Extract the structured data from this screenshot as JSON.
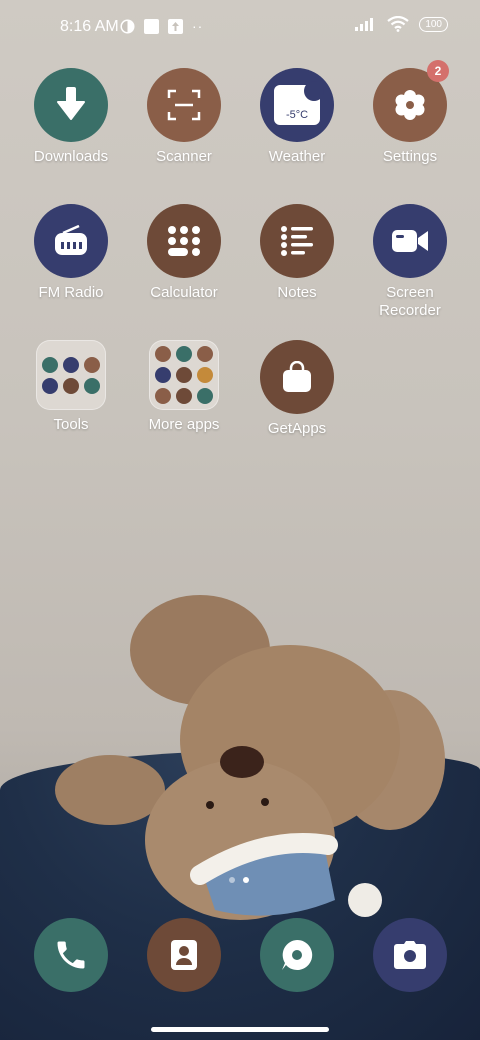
{
  "status_bar": {
    "time": "8:16 AM",
    "battery": "100",
    "icons": [
      "signal-icon",
      "wifi-icon",
      "battery-icon"
    ]
  },
  "apps": {
    "downloads": {
      "label": "Downloads",
      "color": "#3a6f68"
    },
    "scanner": {
      "label": "Scanner",
      "color": "#8a5e48"
    },
    "weather": {
      "label": "Weather",
      "color": "#363d6e",
      "temp": "-5°C"
    },
    "settings": {
      "label": "Settings",
      "color": "#8a5e48",
      "badge": "2"
    },
    "fm_radio": {
      "label": "FM Radio",
      "color": "#363d6e"
    },
    "calculator": {
      "label": "Calculator",
      "color": "#6e4a38"
    },
    "notes": {
      "label": "Notes",
      "color": "#6e4a38"
    },
    "screen_recorder": {
      "label": "Screen Recorder",
      "color": "#363d6e"
    },
    "tools": {
      "label": "Tools"
    },
    "more_apps": {
      "label": "More apps"
    },
    "getapps": {
      "label": "GetApps",
      "color": "#6e4a38"
    }
  },
  "page_indicator": {
    "pages": 2,
    "current": 2
  },
  "dock": [
    {
      "name": "phone",
      "color": "#3a6f68"
    },
    {
      "name": "contacts",
      "color": "#6e4a38"
    },
    {
      "name": "messaging",
      "color": "#3a6f68"
    },
    {
      "name": "camera",
      "color": "#363d6e"
    }
  ]
}
